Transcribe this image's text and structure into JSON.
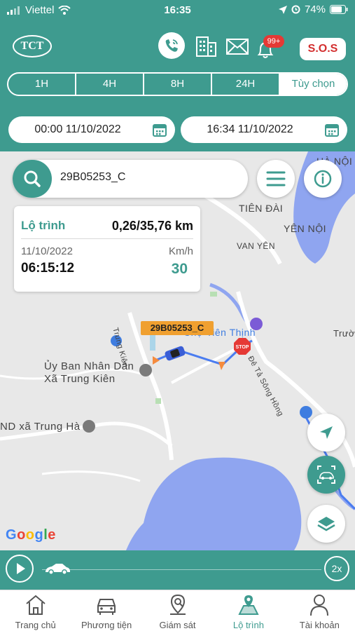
{
  "status_bar": {
    "carrier": "Viettel",
    "time": "16:35",
    "battery": "74%"
  },
  "header": {
    "logo": "TCT",
    "icons": [
      "phone-icon",
      "building-icon",
      "mail-icon",
      "bell-icon"
    ],
    "notification_badge": "99+",
    "sos_label": "S.O.S"
  },
  "range_tabs": [
    {
      "label": "1H",
      "active": false
    },
    {
      "label": "4H",
      "active": false
    },
    {
      "label": "8H",
      "active": false
    },
    {
      "label": "24H",
      "active": false
    },
    {
      "label": "Tùy chọn",
      "active": true
    }
  ],
  "date_range": {
    "from": "00:00 11/10/2022",
    "to": "16:34 11/10/2022"
  },
  "search": {
    "value": "29B05253_C"
  },
  "map": {
    "places": [
      "HÀ NỘI",
      "TIÊN ĐÀI",
      "YÊN NỘI",
      "VAN YÊN",
      "Trung Kiên",
      "Chợ Tiên Thịnh",
      "Ủy Ban Nhân Dân",
      "Xã Trung Kiên",
      "ND xã Trung Hà",
      "Trườ",
      "Đê Tả Sông Hồng",
      "Google"
    ],
    "vehicle_plate": "29B05253_C"
  },
  "route_info": {
    "label": "Lộ trình",
    "distance": "0,26/35,76 km",
    "date": "11/10/2022",
    "time": "06:15:12",
    "speed_unit": "Km/h",
    "speed": "30"
  },
  "player": {
    "speed_label": "2x"
  },
  "nav": [
    {
      "label": "Trang chủ",
      "icon": "home-icon",
      "active": false
    },
    {
      "label": "Phương tiện",
      "icon": "car-icon",
      "active": false
    },
    {
      "label": "Giám sát",
      "icon": "monitor-pin-icon",
      "active": false
    },
    {
      "label": "Lộ trình",
      "icon": "route-map-icon",
      "active": true
    },
    {
      "label": "Tài khoản",
      "icon": "user-icon",
      "active": false
    }
  ],
  "colors": {
    "primary": "#3e9b8f",
    "route": "#4a7cf0",
    "sos": "#d32f2f",
    "badge": "#e53935",
    "plate": "#f0a030",
    "water": "#8fa5f0"
  }
}
